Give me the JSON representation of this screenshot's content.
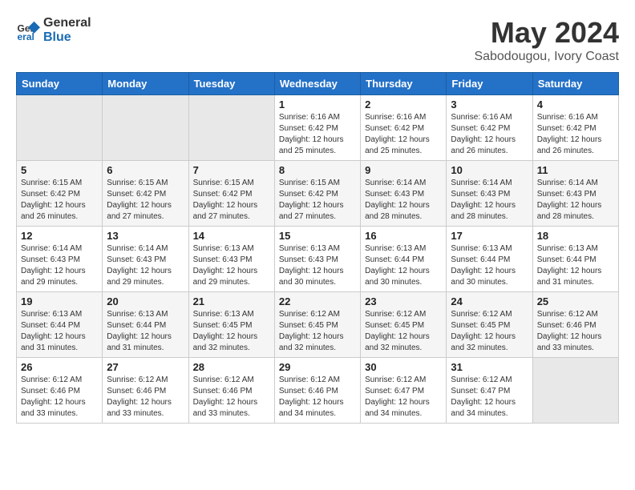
{
  "logo": {
    "line1": "General",
    "line2": "Blue"
  },
  "title": "May 2024",
  "location": "Sabodougou, Ivory Coast",
  "days_header": [
    "Sunday",
    "Monday",
    "Tuesday",
    "Wednesday",
    "Thursday",
    "Friday",
    "Saturday"
  ],
  "weeks": [
    [
      {
        "day": "",
        "info": ""
      },
      {
        "day": "",
        "info": ""
      },
      {
        "day": "",
        "info": ""
      },
      {
        "day": "1",
        "info": "Sunrise: 6:16 AM\nSunset: 6:42 PM\nDaylight: 12 hours\nand 25 minutes."
      },
      {
        "day": "2",
        "info": "Sunrise: 6:16 AM\nSunset: 6:42 PM\nDaylight: 12 hours\nand 25 minutes."
      },
      {
        "day": "3",
        "info": "Sunrise: 6:16 AM\nSunset: 6:42 PM\nDaylight: 12 hours\nand 26 minutes."
      },
      {
        "day": "4",
        "info": "Sunrise: 6:16 AM\nSunset: 6:42 PM\nDaylight: 12 hours\nand 26 minutes."
      }
    ],
    [
      {
        "day": "5",
        "info": "Sunrise: 6:15 AM\nSunset: 6:42 PM\nDaylight: 12 hours\nand 26 minutes."
      },
      {
        "day": "6",
        "info": "Sunrise: 6:15 AM\nSunset: 6:42 PM\nDaylight: 12 hours\nand 27 minutes."
      },
      {
        "day": "7",
        "info": "Sunrise: 6:15 AM\nSunset: 6:42 PM\nDaylight: 12 hours\nand 27 minutes."
      },
      {
        "day": "8",
        "info": "Sunrise: 6:15 AM\nSunset: 6:42 PM\nDaylight: 12 hours\nand 27 minutes."
      },
      {
        "day": "9",
        "info": "Sunrise: 6:14 AM\nSunset: 6:43 PM\nDaylight: 12 hours\nand 28 minutes."
      },
      {
        "day": "10",
        "info": "Sunrise: 6:14 AM\nSunset: 6:43 PM\nDaylight: 12 hours\nand 28 minutes."
      },
      {
        "day": "11",
        "info": "Sunrise: 6:14 AM\nSunset: 6:43 PM\nDaylight: 12 hours\nand 28 minutes."
      }
    ],
    [
      {
        "day": "12",
        "info": "Sunrise: 6:14 AM\nSunset: 6:43 PM\nDaylight: 12 hours\nand 29 minutes."
      },
      {
        "day": "13",
        "info": "Sunrise: 6:14 AM\nSunset: 6:43 PM\nDaylight: 12 hours\nand 29 minutes."
      },
      {
        "day": "14",
        "info": "Sunrise: 6:13 AM\nSunset: 6:43 PM\nDaylight: 12 hours\nand 29 minutes."
      },
      {
        "day": "15",
        "info": "Sunrise: 6:13 AM\nSunset: 6:43 PM\nDaylight: 12 hours\nand 30 minutes."
      },
      {
        "day": "16",
        "info": "Sunrise: 6:13 AM\nSunset: 6:44 PM\nDaylight: 12 hours\nand 30 minutes."
      },
      {
        "day": "17",
        "info": "Sunrise: 6:13 AM\nSunset: 6:44 PM\nDaylight: 12 hours\nand 30 minutes."
      },
      {
        "day": "18",
        "info": "Sunrise: 6:13 AM\nSunset: 6:44 PM\nDaylight: 12 hours\nand 31 minutes."
      }
    ],
    [
      {
        "day": "19",
        "info": "Sunrise: 6:13 AM\nSunset: 6:44 PM\nDaylight: 12 hours\nand 31 minutes."
      },
      {
        "day": "20",
        "info": "Sunrise: 6:13 AM\nSunset: 6:44 PM\nDaylight: 12 hours\nand 31 minutes."
      },
      {
        "day": "21",
        "info": "Sunrise: 6:13 AM\nSunset: 6:45 PM\nDaylight: 12 hours\nand 32 minutes."
      },
      {
        "day": "22",
        "info": "Sunrise: 6:12 AM\nSunset: 6:45 PM\nDaylight: 12 hours\nand 32 minutes."
      },
      {
        "day": "23",
        "info": "Sunrise: 6:12 AM\nSunset: 6:45 PM\nDaylight: 12 hours\nand 32 minutes."
      },
      {
        "day": "24",
        "info": "Sunrise: 6:12 AM\nSunset: 6:45 PM\nDaylight: 12 hours\nand 32 minutes."
      },
      {
        "day": "25",
        "info": "Sunrise: 6:12 AM\nSunset: 6:46 PM\nDaylight: 12 hours\nand 33 minutes."
      }
    ],
    [
      {
        "day": "26",
        "info": "Sunrise: 6:12 AM\nSunset: 6:46 PM\nDaylight: 12 hours\nand 33 minutes."
      },
      {
        "day": "27",
        "info": "Sunrise: 6:12 AM\nSunset: 6:46 PM\nDaylight: 12 hours\nand 33 minutes."
      },
      {
        "day": "28",
        "info": "Sunrise: 6:12 AM\nSunset: 6:46 PM\nDaylight: 12 hours\nand 33 minutes."
      },
      {
        "day": "29",
        "info": "Sunrise: 6:12 AM\nSunset: 6:46 PM\nDaylight: 12 hours\nand 34 minutes."
      },
      {
        "day": "30",
        "info": "Sunrise: 6:12 AM\nSunset: 6:47 PM\nDaylight: 12 hours\nand 34 minutes."
      },
      {
        "day": "31",
        "info": "Sunrise: 6:12 AM\nSunset: 6:47 PM\nDaylight: 12 hours\nand 34 minutes."
      },
      {
        "day": "",
        "info": ""
      }
    ]
  ]
}
